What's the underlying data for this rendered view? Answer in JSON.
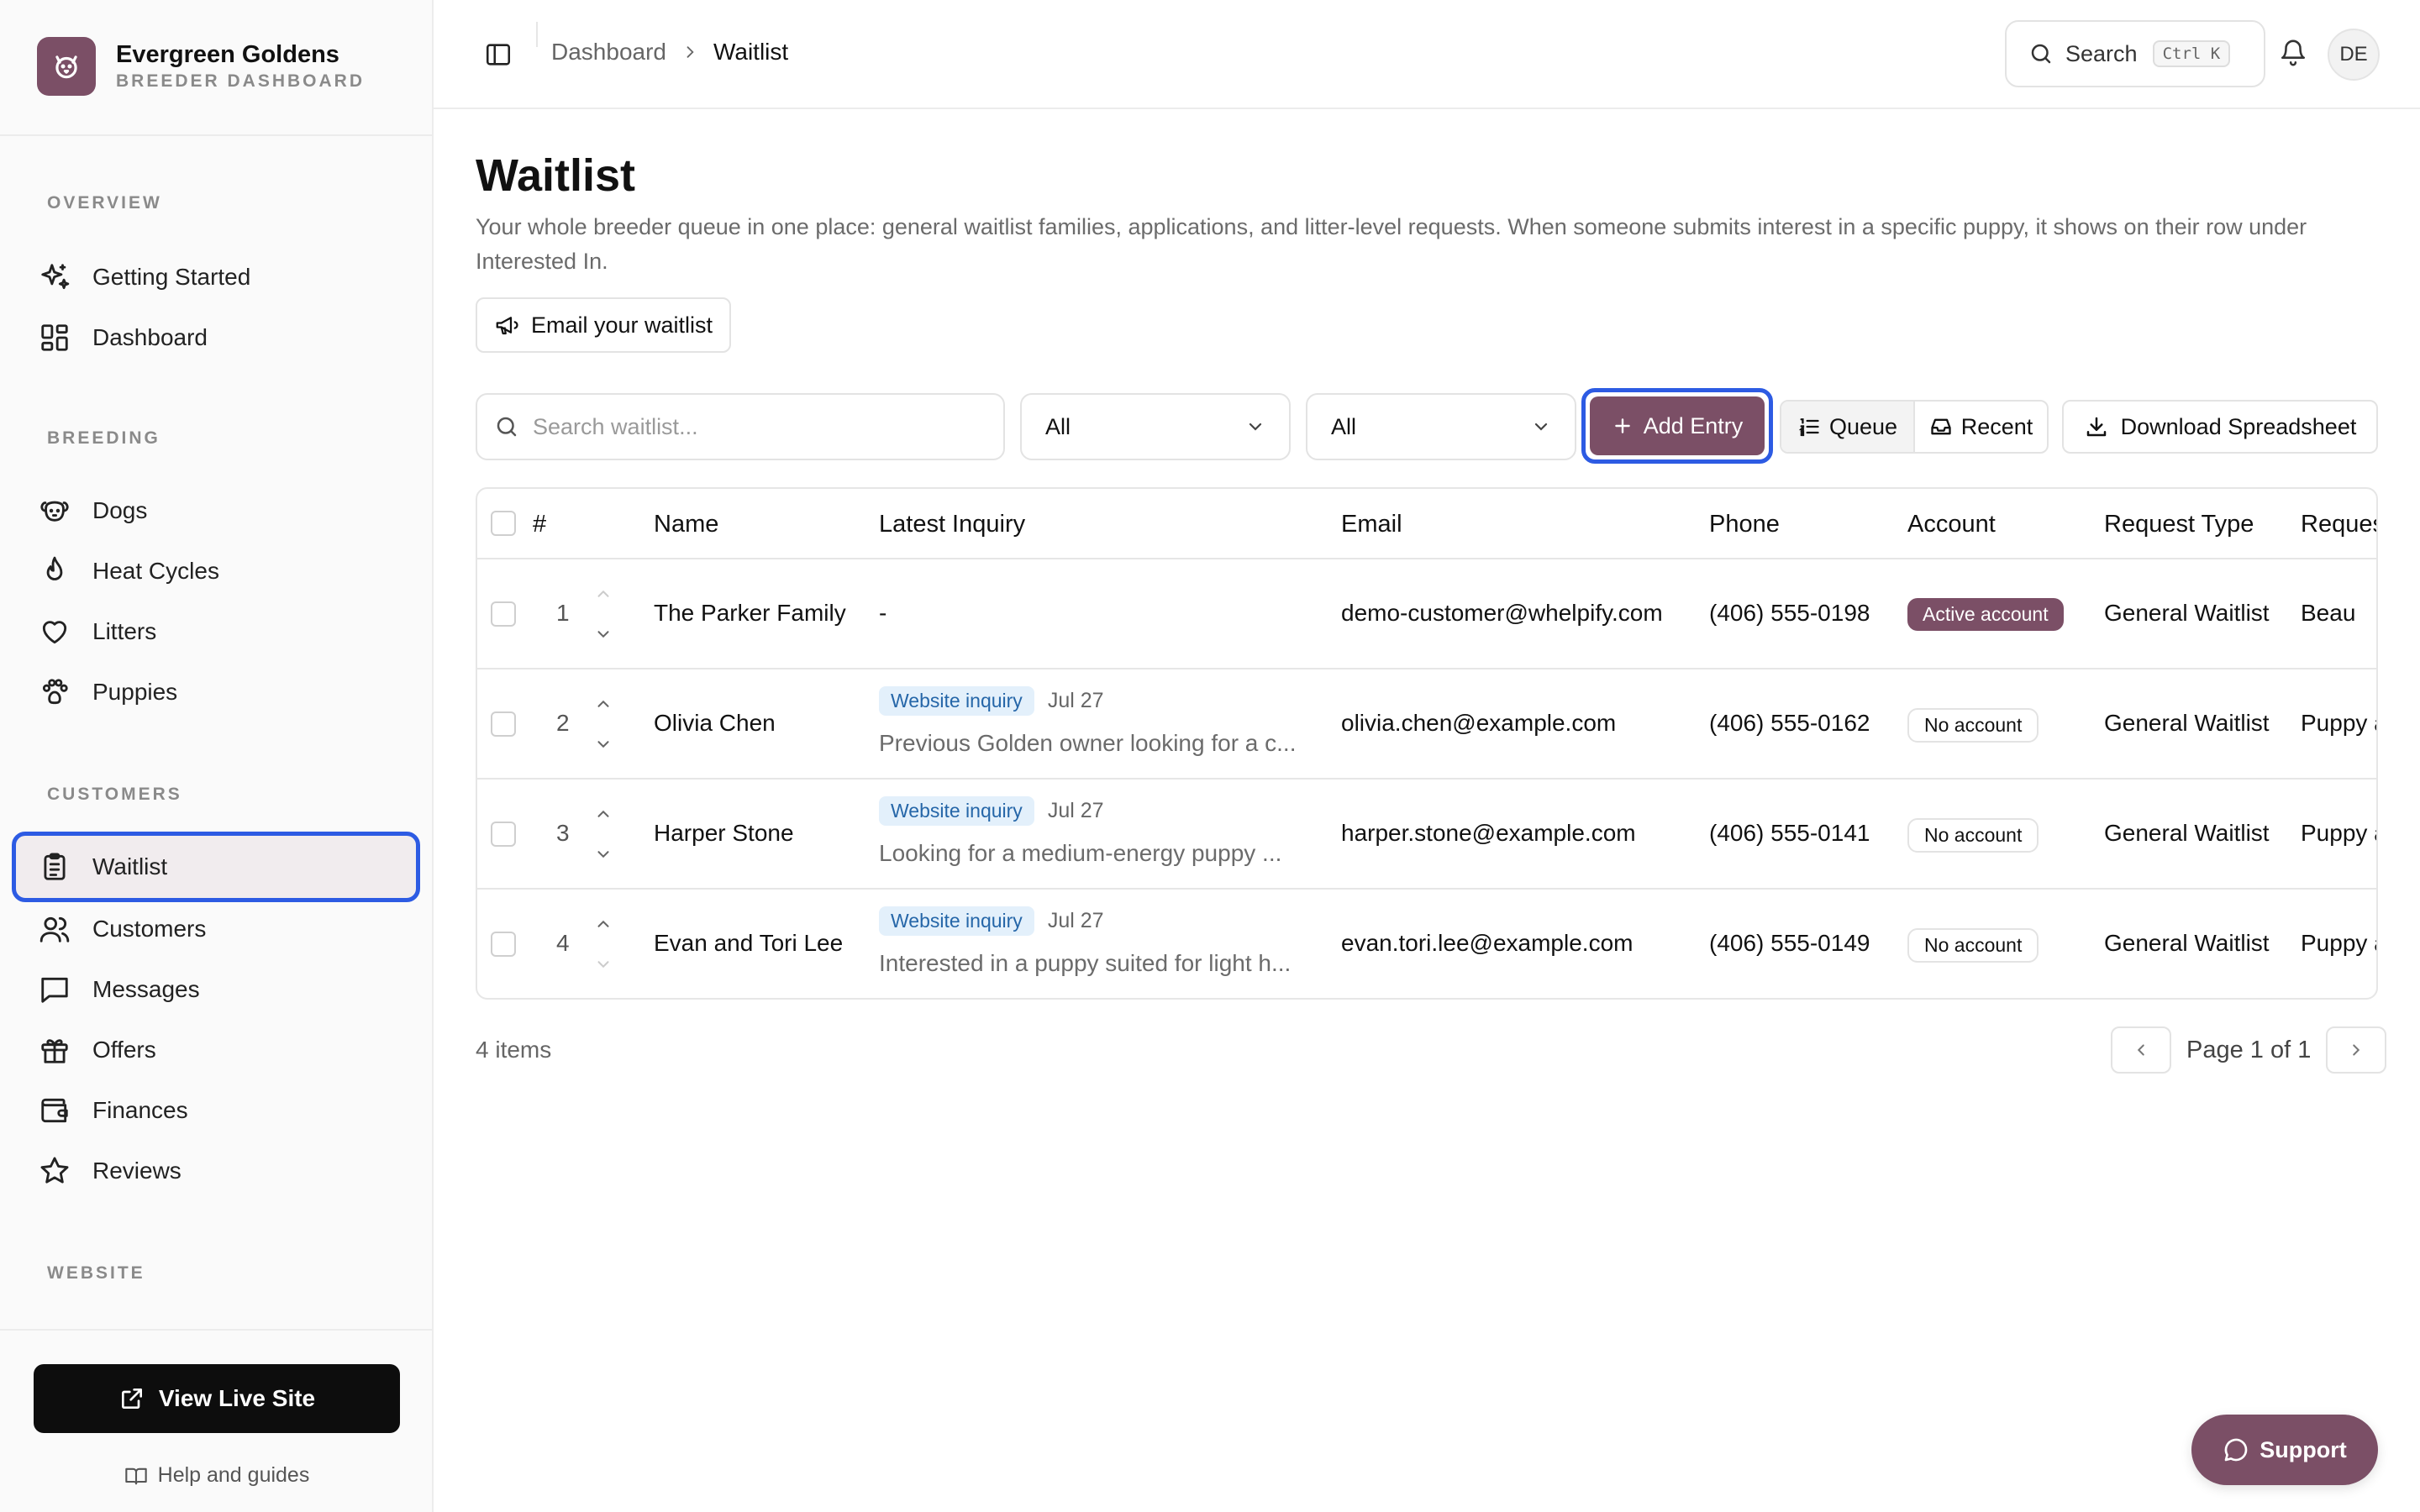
{
  "brand": {
    "name": "Evergreen Goldens",
    "subtitle": "BREEDER DASHBOARD"
  },
  "sidebar": {
    "sections": [
      {
        "label": "OVERVIEW",
        "items": [
          {
            "label": "Getting Started",
            "icon": "sparkles-icon"
          },
          {
            "label": "Dashboard",
            "icon": "grid-icon"
          }
        ]
      },
      {
        "label": "BREEDING",
        "items": [
          {
            "label": "Dogs",
            "icon": "dog-icon"
          },
          {
            "label": "Heat Cycles",
            "icon": "flame-icon"
          },
          {
            "label": "Litters",
            "icon": "heart-icon"
          },
          {
            "label": "Puppies",
            "icon": "paw-icon"
          }
        ]
      },
      {
        "label": "CUSTOMERS",
        "items": [
          {
            "label": "Waitlist",
            "icon": "clipboard-list-icon",
            "active": true
          },
          {
            "label": "Customers",
            "icon": "users-icon"
          },
          {
            "label": "Messages",
            "icon": "message-square-icon"
          },
          {
            "label": "Offers",
            "icon": "gift-icon"
          },
          {
            "label": "Finances",
            "icon": "wallet-icon"
          },
          {
            "label": "Reviews",
            "icon": "star-icon"
          }
        ]
      },
      {
        "label": "WEBSITE",
        "items": []
      }
    ],
    "view_live_label": "View Live Site",
    "help_label": "Help and guides"
  },
  "topbar": {
    "breadcrumb": {
      "parent": "Dashboard",
      "current": "Waitlist"
    },
    "search_label": "Search",
    "search_shortcut": "Ctrl K",
    "avatar_initials": "DE"
  },
  "main": {
    "title": "Waitlist",
    "description": "Your whole breeder queue in one place: general waitlist families, applications, and litter-level requests. When someone submits interest in a specific puppy, it shows on their row under Interested In.",
    "email_button": "Email your waitlist",
    "search_placeholder": "Search waitlist...",
    "filter1_value": "All",
    "filter2_value": "All",
    "add_entry_label": "Add Entry",
    "view_queue_label": "Queue",
    "view_recent_label": "Recent",
    "download_label": "Download Spreadsheet"
  },
  "table": {
    "columns": {
      "num": "#",
      "name": "Name",
      "inquiry": "Latest Inquiry",
      "email": "Email",
      "phone": "Phone",
      "account": "Account",
      "request_type": "Request Type",
      "request": "Reques"
    },
    "rows": [
      {
        "num": "1",
        "name": "The Parker Family",
        "inquiry_badge": "",
        "inquiry_date": "",
        "inquiry_text": "-",
        "email": "demo-customer@whelpify.com",
        "phone": "(406) 555-0198",
        "account": "Active account",
        "account_status": "active",
        "request_type": "General Waitlist",
        "request": "Beau"
      },
      {
        "num": "2",
        "name": "Olivia Chen",
        "inquiry_badge": "Website inquiry",
        "inquiry_date": "Jul 27",
        "inquiry_text": "Previous Golden owner looking for a c...",
        "email": "olivia.chen@example.com",
        "phone": "(406) 555-0162",
        "account": "No account",
        "account_status": "none",
        "request_type": "General Waitlist",
        "request": "Puppy a"
      },
      {
        "num": "3",
        "name": "Harper Stone",
        "inquiry_badge": "Website inquiry",
        "inquiry_date": "Jul 27",
        "inquiry_text": "Looking for a medium-energy puppy ...",
        "email": "harper.stone@example.com",
        "phone": "(406) 555-0141",
        "account": "No account",
        "account_status": "none",
        "request_type": "General Waitlist",
        "request": "Puppy a"
      },
      {
        "num": "4",
        "name": "Evan and Tori Lee",
        "inquiry_badge": "Website inquiry",
        "inquiry_date": "Jul 27",
        "inquiry_text": "Interested in a puppy suited for light h...",
        "email": "evan.tori.lee@example.com",
        "phone": "(406) 555-0149",
        "account": "No account",
        "account_status": "none",
        "request_type": "General Waitlist",
        "request": "Puppy a"
      }
    ]
  },
  "footer": {
    "items_count": "4 items",
    "page_label": "Page 1 of 1"
  },
  "support_label": "Support",
  "colors": {
    "brand": "#7b4f66",
    "focus_ring": "#2d5be3",
    "badge_bg": "#e3f0fb",
    "badge_text": "#2566a8"
  }
}
